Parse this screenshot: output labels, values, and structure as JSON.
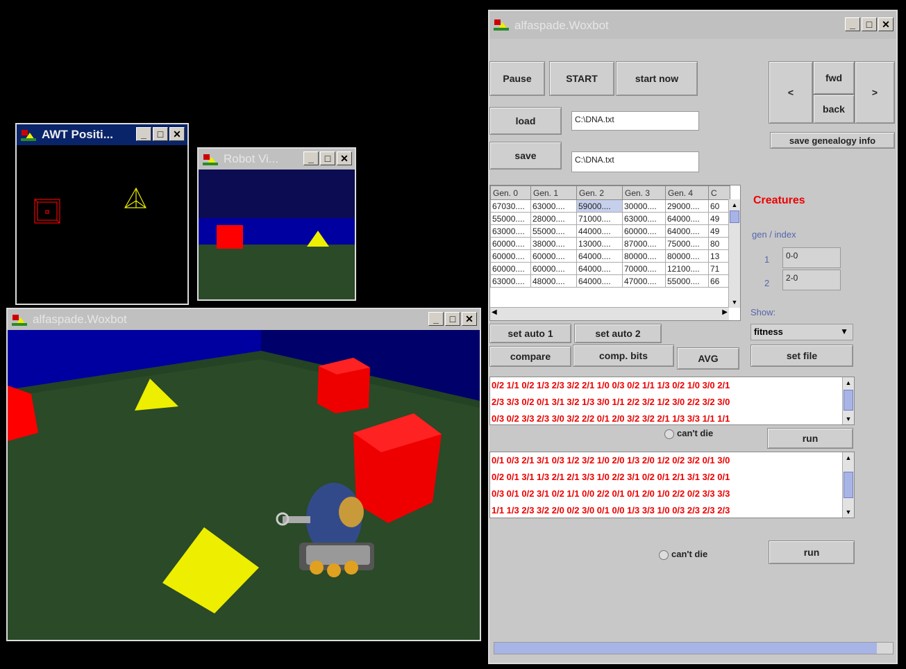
{
  "awt_window": {
    "title": "AWT Positi..."
  },
  "robot_window": {
    "title": "Robot Vi..."
  },
  "view_window": {
    "title": "alfaspade.Woxbot"
  },
  "control_window": {
    "title": "alfaspade.Woxbot",
    "buttons": {
      "pause": "Pause",
      "start": "START",
      "start_now": "start now",
      "load": "load",
      "save": "save",
      "prev": "<",
      "fwd": "fwd",
      "back": "back",
      "next": ">",
      "save_genealogy": "save genealogy info",
      "set_auto_1": "set auto 1",
      "set_auto_2": "set auto 2",
      "compare": "compare",
      "comp_bits": "comp. bits",
      "avg": "AVG",
      "set_file": "set file",
      "run1": "run",
      "run2": "run"
    },
    "load_path": "C:\\DNA.txt",
    "save_path": "C:\\DNA.txt",
    "table": {
      "headers": [
        "Gen. 0",
        "Gen. 1",
        "Gen. 2",
        "Gen. 3",
        "Gen. 4",
        "C"
      ],
      "rows": [
        [
          "67030....",
          "63000....",
          "59000....",
          "30000....",
          "29000....",
          "60"
        ],
        [
          "55000....",
          "28000....",
          "71000....",
          "63000....",
          "64000....",
          "49"
        ],
        [
          "63000....",
          "55000....",
          "44000....",
          "60000....",
          "64000....",
          "49"
        ],
        [
          "60000....",
          "38000....",
          "13000....",
          "87000....",
          "75000....",
          "80"
        ],
        [
          "60000....",
          "60000....",
          "64000....",
          "80000....",
          "80000....",
          "13"
        ],
        [
          "60000....",
          "60000....",
          "64000....",
          "70000....",
          "12100....",
          "71"
        ],
        [
          "63000....",
          "48000....",
          "64000....",
          "47000....",
          "55000....",
          "66"
        ]
      ]
    },
    "creatures_label": "Creatures",
    "gen_index_label": "gen / index",
    "slot1_label": "1",
    "slot1_value": "0-0",
    "slot2_label": "2",
    "slot2_value": "2-0",
    "show_label": "Show:",
    "show_value": "fitness",
    "cant_die_1": "can't die",
    "cant_die_2": "can't die",
    "dna1": [
      "0/2 1/1 0/2 1/3 2/3 3/2 2/1 1/0 0/3 0/2 1/1 1/3 0/2 1/0 3/0 2/1",
      "2/3 3/3 0/2 0/1 3/1 3/2 1/3 3/0 1/1 2/2 3/2 1/2 3/0 2/2 3/2 3/0",
      "0/3 0/2 3/3 2/3 3/0 3/2 2/2 0/1 2/0 3/2 3/2 2/1 1/3 3/3 1/1 1/1"
    ],
    "dna2": [
      "0/1 0/3 2/1 3/1 0/3 1/2 3/2 1/0 2/0 1/3 2/0 1/2 0/2 3/2 0/1 3/0",
      "0/2 0/1 3/1 1/3 2/1 2/1 3/3 1/0 2/2 3/1 0/2 0/1 2/1 3/1 3/2 0/1",
      "0/3 0/1 0/2 3/1 0/2 1/1 0/0 2/2 0/1 0/1 2/0 1/0 2/2 0/2 3/3 3/3",
      "1/1 1/3 2/3 3/2 2/0 0/2 3/0 0/1 0/0 1/3 3/3 1/0 0/3 2/3 2/3 2/3"
    ],
    "progress": 0.96
  },
  "colors": {
    "red": "#ff0000",
    "yellow": "#ffff00",
    "floor": "#2a4a28",
    "sky": "#000090",
    "titlebar_active": "#0a246a"
  }
}
